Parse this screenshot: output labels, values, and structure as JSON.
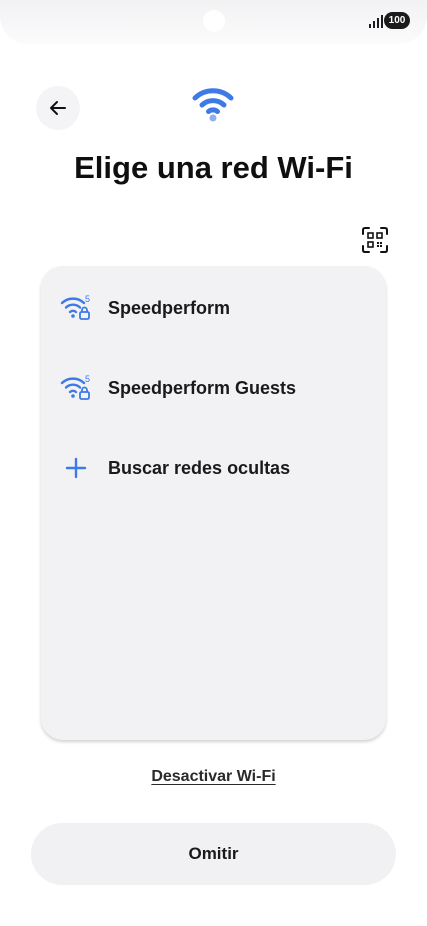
{
  "status_bar": {
    "battery": "100"
  },
  "header": {
    "title": "Elige una red Wi-Fi"
  },
  "networks": [
    {
      "name": "Speedperform",
      "band": "5",
      "icon": "wifi-lock-icon"
    },
    {
      "name": "Speedperform Guests",
      "band": "5",
      "icon": "wifi-lock-icon"
    }
  ],
  "add_network": {
    "label": "Buscar redes ocultas",
    "icon": "plus-icon"
  },
  "footer": {
    "disable_wifi": "Desactivar Wi-Fi",
    "skip": "Omitir"
  },
  "colors": {
    "accent": "#3f79e6",
    "card": "#f2f2f4"
  }
}
